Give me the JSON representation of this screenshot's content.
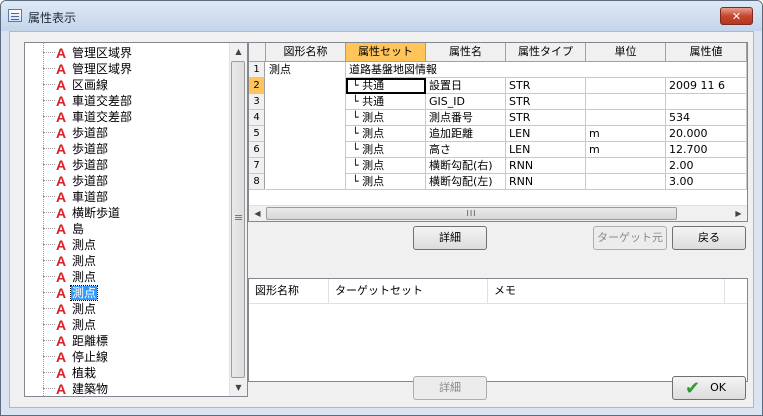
{
  "window": {
    "title": "属性表示",
    "close_glyph": "✕"
  },
  "tree": {
    "items": [
      {
        "label": "管理区域界"
      },
      {
        "label": "管理区域界"
      },
      {
        "label": "区画線"
      },
      {
        "label": "車道交差部"
      },
      {
        "label": "車道交差部"
      },
      {
        "label": "歩道部"
      },
      {
        "label": "歩道部"
      },
      {
        "label": "歩道部"
      },
      {
        "label": "歩道部"
      },
      {
        "label": "車道部"
      },
      {
        "label": "横断歩道"
      },
      {
        "label": "島"
      },
      {
        "label": "測点"
      },
      {
        "label": "測点"
      },
      {
        "label": "測点"
      },
      {
        "label": "測点",
        "selected": true
      },
      {
        "label": "測点"
      },
      {
        "label": "測点"
      },
      {
        "label": "距離標"
      },
      {
        "label": "停止線"
      },
      {
        "label": "植栽"
      },
      {
        "label": "建築物"
      }
    ],
    "icon_glyph": "A",
    "scroll_up": "▲",
    "scroll_down": "▼"
  },
  "attr_grid": {
    "columns": [
      "図形名称",
      "属性セット",
      "属性名",
      "属性タイプ",
      "単位",
      "属性値"
    ],
    "shape_name": "測点",
    "group": "道路基盤地図情報",
    "rows": [
      {
        "num": "1",
        "set": "",
        "name": "",
        "type": "",
        "unit": "",
        "value": ""
      },
      {
        "num": "2",
        "set": "└ 共通",
        "name": "設置日",
        "type": "STR",
        "unit": "",
        "value": "2009 11 6"
      },
      {
        "num": "3",
        "set": "└ 共通",
        "name": "GIS_ID",
        "type": "STR",
        "unit": "",
        "value": ""
      },
      {
        "num": "4",
        "set": "└ 測点",
        "name": "測点番号",
        "type": "STR",
        "unit": "",
        "value": "534"
      },
      {
        "num": "5",
        "set": "└ 測点",
        "name": "追加距離",
        "type": "LEN",
        "unit": "m",
        "value": "20.000"
      },
      {
        "num": "6",
        "set": "└ 測点",
        "name": "高さ",
        "type": "LEN",
        "unit": "m",
        "value": "12.700"
      },
      {
        "num": "7",
        "set": "└ 測点",
        "name": "横断勾配(右)",
        "type": "RNN",
        "unit": "",
        "value": "2.00"
      },
      {
        "num": "8",
        "set": "└ 測点",
        "name": "横断勾配(左)",
        "type": "RNN",
        "unit": "",
        "value": "3.00"
      }
    ],
    "scroll_left": "◀",
    "scroll_right": "▶",
    "thumb_grip": "III"
  },
  "buttons": {
    "detail_top": "詳細",
    "target_source": "ターゲット元",
    "back": "戻る",
    "detail_bottom": "詳細",
    "ok": "OK",
    "ok_check": "✔"
  },
  "target_grid": {
    "columns": [
      "図形名称",
      "ターゲットセット",
      "メモ"
    ]
  }
}
